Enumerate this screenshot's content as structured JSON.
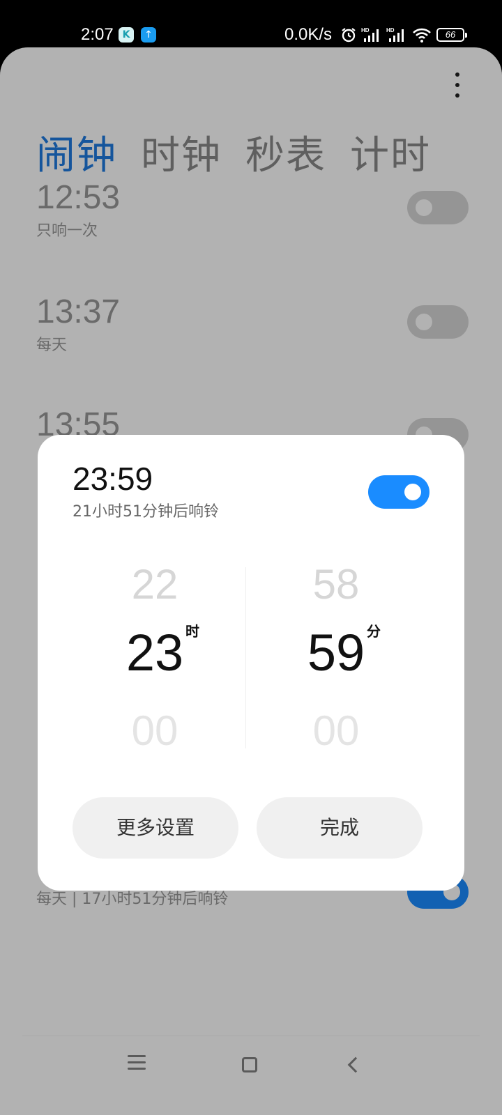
{
  "status_bar": {
    "time": "2:07",
    "network_speed": "0.0K/s",
    "battery": "66",
    "icons": [
      "k-app-icon",
      "upload-icon",
      "alarm-clock-icon",
      "signal-hd-icon",
      "signal-hd-icon",
      "wifi-icon",
      "battery-icon"
    ]
  },
  "tabs": [
    {
      "label": "闹钟",
      "active": true
    },
    {
      "label": "时钟",
      "active": false
    },
    {
      "label": "秒表",
      "active": false
    },
    {
      "label": "计时",
      "active": false
    }
  ],
  "alarms": [
    {
      "time": "12:53",
      "repeat": "只响一次",
      "enabled": false
    },
    {
      "time": "13:37",
      "repeat": "每天",
      "enabled": false
    },
    {
      "time": "13:55",
      "repeat": "",
      "enabled": false
    },
    {
      "time": "",
      "repeat": "每天 | 17小时51分钟后响铃",
      "enabled": true
    }
  ],
  "dialog": {
    "time": "23:59",
    "subtitle": "21小时51分钟后响铃",
    "enabled": true,
    "hour": {
      "prev": "22",
      "current": "23",
      "next": "00",
      "unit": "时"
    },
    "minute": {
      "prev": "58",
      "current": "59",
      "next": "00",
      "unit": "分"
    },
    "more_settings_label": "更多设置",
    "done_label": "完成"
  },
  "colors": {
    "accent": "#1a8cff",
    "tab_active": "#1f7ae0"
  }
}
